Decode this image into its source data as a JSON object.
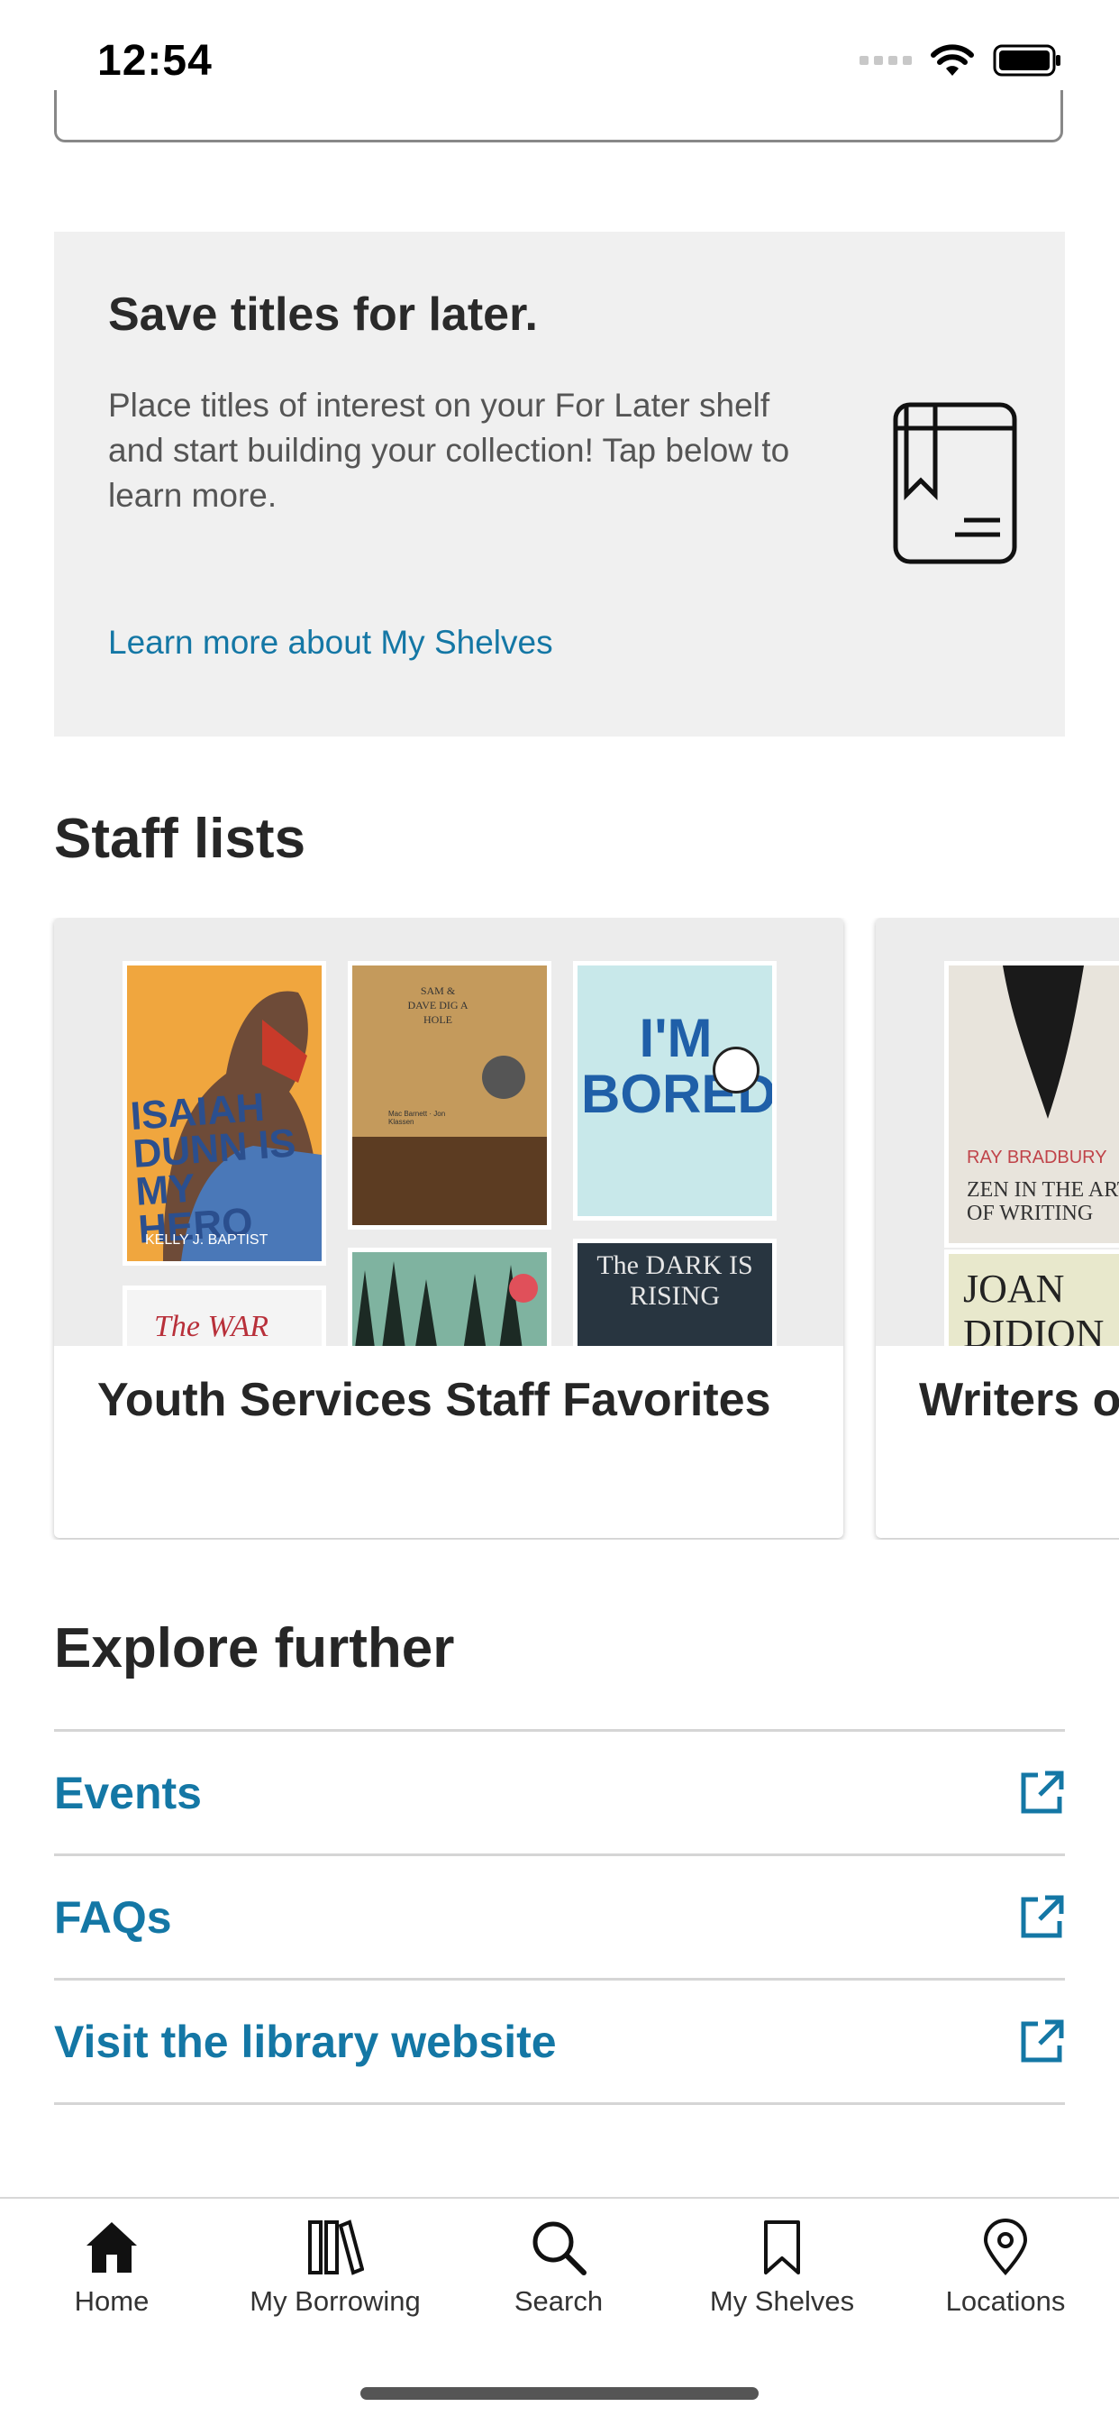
{
  "status_bar": {
    "time": "12:54"
  },
  "promo": {
    "title": "Save titles for later.",
    "body": "Place titles of interest on your For Later shelf and start building your collection! Tap below to learn more.",
    "icon": "shelf-book-icon",
    "link_label": "Learn more about My Shelves"
  },
  "staff_lists": {
    "title": "Staff lists",
    "cards": [
      {
        "title": "Youth Services Staff Favorites",
        "covers": [
          {
            "title": "ISAIAH DUNN IS MY HERO",
            "author": "KELLY J. BAPTIST"
          },
          {
            "title": "SAM & DAVE DIG A HOLE",
            "author": "Mac Barnett · Jon Klassen"
          },
          {
            "title": "I'M BORED"
          },
          {
            "title": "The WAR that"
          },
          {
            "title": ""
          },
          {
            "title": "The DARK IS RISING"
          }
        ]
      },
      {
        "title": "Writers o",
        "covers": [
          {
            "title": "ZEN IN THE ART OF WRITING",
            "author": "RAY BRADBURY"
          },
          {
            "title": "JOAN DIDION"
          }
        ]
      }
    ]
  },
  "explore": {
    "title": "Explore further",
    "items": [
      {
        "label": "Events",
        "icon": "external-link-icon"
      },
      {
        "label": "FAQs",
        "icon": "external-link-icon"
      },
      {
        "label": "Visit the library website",
        "icon": "external-link-icon"
      }
    ]
  },
  "tab_bar": {
    "tabs": [
      {
        "label": "Home",
        "icon": "home-icon"
      },
      {
        "label": "My Borrowing",
        "icon": "books-icon"
      },
      {
        "label": "Search",
        "icon": "search-icon"
      },
      {
        "label": "My Shelves",
        "icon": "bookmark-icon"
      },
      {
        "label": "Locations",
        "icon": "location-pin-icon"
      }
    ]
  },
  "colors": {
    "link": "#1477a5",
    "promo_bg": "#f0f0f0",
    "text": "#262626"
  }
}
